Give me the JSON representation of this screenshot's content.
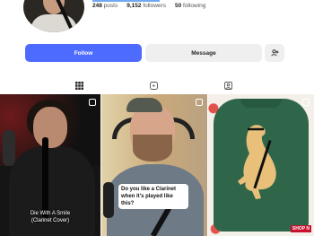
{
  "profile": {
    "stats": {
      "posts": "248",
      "posts_label": "posts",
      "followers": "9,152",
      "followers_label": "followers",
      "following": "50",
      "following_label": "following"
    }
  },
  "actions": {
    "follow_label": "Follow",
    "message_label": "Message"
  },
  "tabs": [
    "posts-grid",
    "reels",
    "tagged"
  ],
  "posts": [
    {
      "caption": "Die With A Smile\n(Clarinet Cover)"
    },
    {
      "caption": "Do you like a Clarinet when it's played like this?"
    },
    {
      "badge": "SHOP N"
    }
  ],
  "colors": {
    "accent": "#4d6bfe",
    "secondary_button": "#efefef",
    "sweater": "#2f6649"
  }
}
